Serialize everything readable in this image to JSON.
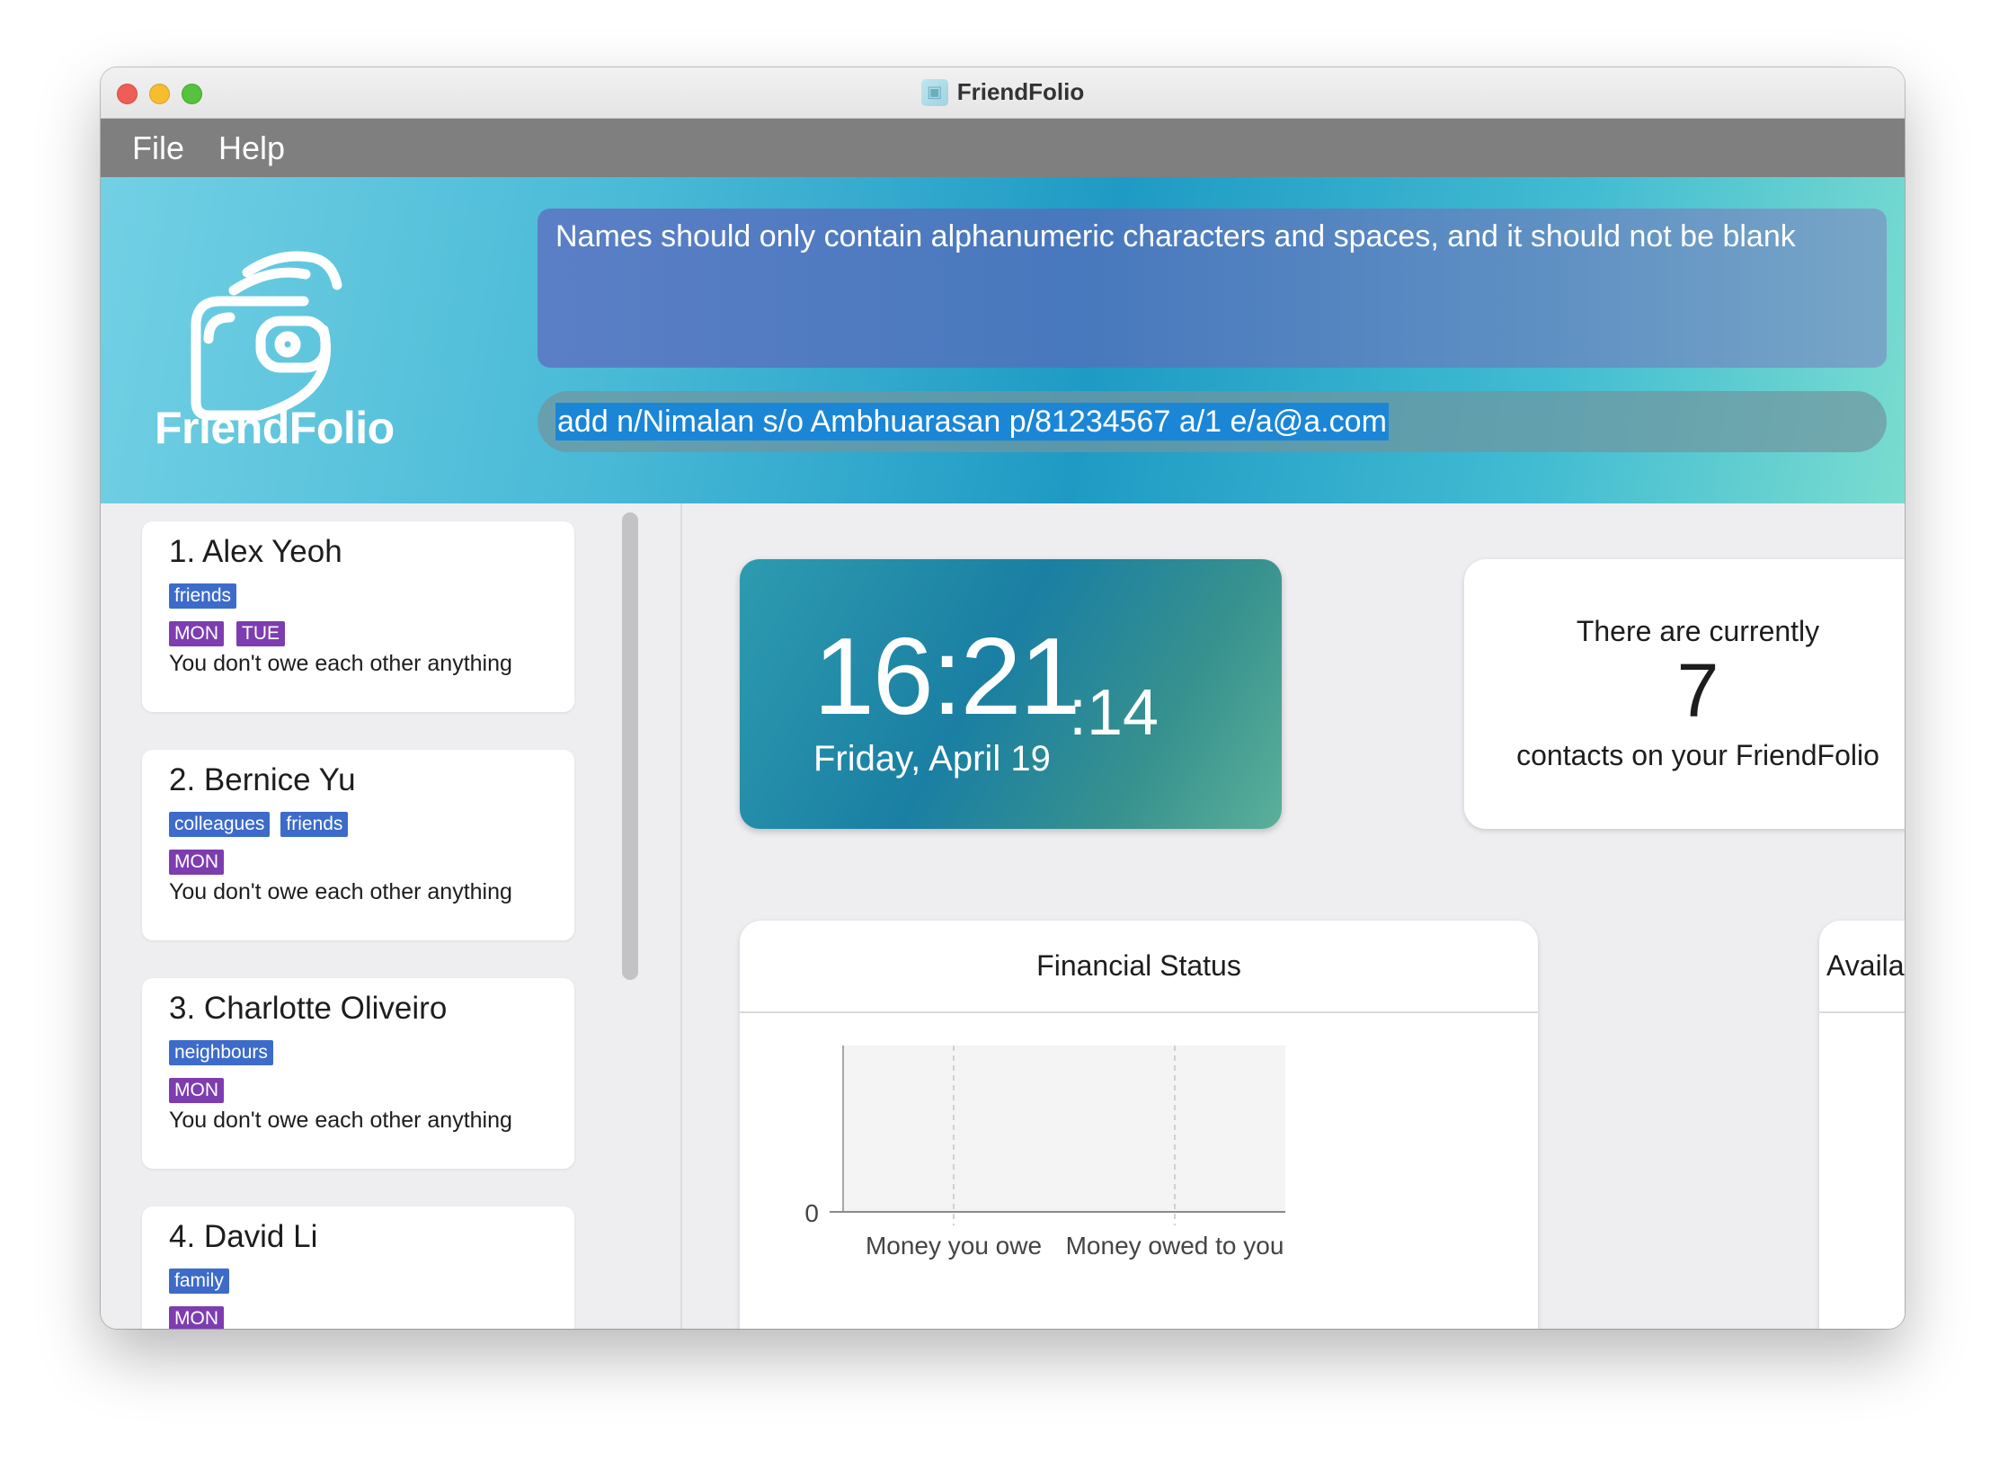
{
  "window": {
    "title": "FriendFolio"
  },
  "menu": [
    "File",
    "Help"
  ],
  "header": {
    "logo_text": "FriendFolio",
    "result_message": "Names should only contain alphanumeric characters and spaces, and it should not be blank",
    "command_input": "add n/Nimalan s/o Ambhuarasan p/81234567 a/1 e/a@a.com"
  },
  "contacts": [
    {
      "name": "1.  Alex Yeoh",
      "tags": [
        "friends"
      ],
      "days": [
        "MON",
        "TUE"
      ],
      "debt": "You don't owe each other anything"
    },
    {
      "name": "2.  Bernice Yu",
      "tags": [
        "colleagues",
        "friends"
      ],
      "days": [
        "MON"
      ],
      "debt": "You don't owe each other anything"
    },
    {
      "name": "3.  Charlotte Oliveiro",
      "tags": [
        "neighbours"
      ],
      "days": [
        "MON"
      ],
      "debt": "You don't owe each other anything"
    },
    {
      "name": "4.  David Li",
      "tags": [
        "family"
      ],
      "days": [
        "MON"
      ],
      "debt": ""
    }
  ],
  "clock": {
    "hm": "16:21",
    "seconds": ":14",
    "date": "Friday, April 19"
  },
  "contacts_summary": {
    "line1": "There are currently",
    "count": "7",
    "line2": "contacts on your FriendFolio"
  },
  "financial": {
    "title": "Financial Status",
    "chart_data": {
      "type": "bar",
      "categories": [
        "Money you owe",
        "Money owed to you"
      ],
      "values": [
        0,
        0
      ],
      "title": "Financial Status",
      "xlabel": "",
      "ylabel": "",
      "y_ticks": [
        "0"
      ],
      "grid": true
    }
  },
  "availability": {
    "title": "Available today"
  },
  "colors": {
    "tag": "#3d6bc9",
    "day_tag": "#7d3db0",
    "selection": "#1b86d6"
  }
}
